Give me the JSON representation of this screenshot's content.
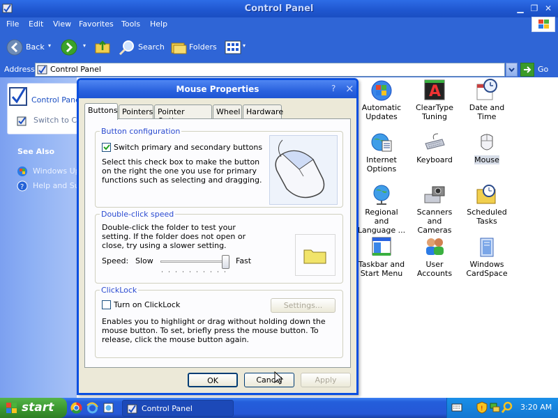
{
  "window": {
    "title": "Control Panel"
  },
  "menu": [
    "File",
    "Edit",
    "View",
    "Favorites",
    "Tools",
    "Help"
  ],
  "toolbar": {
    "back": "Back",
    "search": "Search",
    "folders": "Folders"
  },
  "address": {
    "label": "Address",
    "value": "Control Panel",
    "go": "Go"
  },
  "left_pane": {
    "panel_title": "Control Panel",
    "switch_label": "Switch to Ca",
    "see_also": "See Also",
    "links": [
      "Windows Upd",
      "Help and Sup"
    ]
  },
  "items": [
    {
      "name": "Automatic Updates",
      "icon": "automatic-updates-icon"
    },
    {
      "name": "ClearType Tuning",
      "icon": "cleartype-icon"
    },
    {
      "name": "Date and Time",
      "icon": "date-time-icon"
    },
    {
      "name": "Internet Options",
      "icon": "internet-options-icon"
    },
    {
      "name": "Keyboard",
      "icon": "keyboard-icon"
    },
    {
      "name": "Mouse",
      "icon": "mouse-icon"
    },
    {
      "name": "Regional and Language ...",
      "icon": "regional-language-icon"
    },
    {
      "name": "Scanners and Cameras",
      "icon": "scanners-cameras-icon"
    },
    {
      "name": "Scheduled Tasks",
      "icon": "scheduled-tasks-icon"
    },
    {
      "name": "Taskbar and Start Menu",
      "icon": "taskbar-start-menu-icon"
    },
    {
      "name": "User Accounts",
      "icon": "user-accounts-icon"
    },
    {
      "name": "Windows CardSpace",
      "icon": "cardspace-icon"
    }
  ],
  "dialog": {
    "title": "Mouse Properties",
    "help": "?",
    "close": "×",
    "tabs": [
      "Buttons",
      "Pointers",
      "Pointer Options",
      "Wheel",
      "Hardware"
    ],
    "active_tab": "Buttons",
    "button_config": {
      "title": "Button configuration",
      "checkbox_label": "Switch primary and secondary buttons",
      "checked": true,
      "description": "Select this check box to make the button on the right the one you use for primary functions such as selecting and dragging."
    },
    "double_click": {
      "title": "Double-click speed",
      "description": "Double-click the folder to test your setting. If the folder does not open or close, try using a slower setting.",
      "speed_label": "Speed:",
      "slow": "Slow",
      "fast": "Fast",
      "slider_value": 0.95
    },
    "clicklock": {
      "title": "ClickLock",
      "checkbox_label": "Turn on ClickLock",
      "checked": false,
      "settings_button": "Settings...",
      "description": "Enables you to highlight or drag without holding down the mouse button. To set, briefly press the mouse button. To release, click the mouse button again."
    },
    "buttons": {
      "ok": "OK",
      "cancel": "Cancel",
      "apply": "Apply"
    }
  },
  "taskbar": {
    "start": "start",
    "task": "Control Panel",
    "clock": "3:20 AM"
  },
  "colors": {
    "title_blue": "#2d6ce6",
    "dialog_border": "#0a4fe0",
    "start_green": "#3c9a31",
    "group_title": "#2a4ad0"
  }
}
